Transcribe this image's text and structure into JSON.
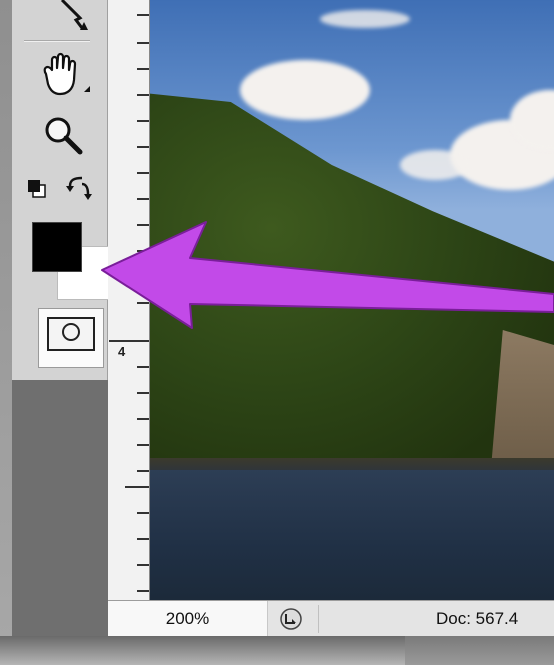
{
  "tools": {
    "items": [
      {
        "name": "path-selection-tool",
        "icon": "direct-selection-arrow-icon"
      },
      {
        "name": "hand-tool",
        "icon": "hand-icon"
      },
      {
        "name": "zoom-tool",
        "icon": "magnifier-icon"
      },
      {
        "name": "default-colors",
        "icon": "default-colors-icon"
      },
      {
        "name": "swap-colors",
        "icon": "swap-arrows-icon"
      }
    ],
    "foreground_color": "#000000",
    "background_color": "#ffffff",
    "quick_mask_icon": "quick-mask-icon"
  },
  "ruler": {
    "label": "4"
  },
  "status_bar": {
    "zoom": "200%",
    "doc_info": "Doc: 567.4"
  },
  "annotation": {
    "arrow_color": "#c24ae8",
    "points_to": "background-color-swatch"
  }
}
